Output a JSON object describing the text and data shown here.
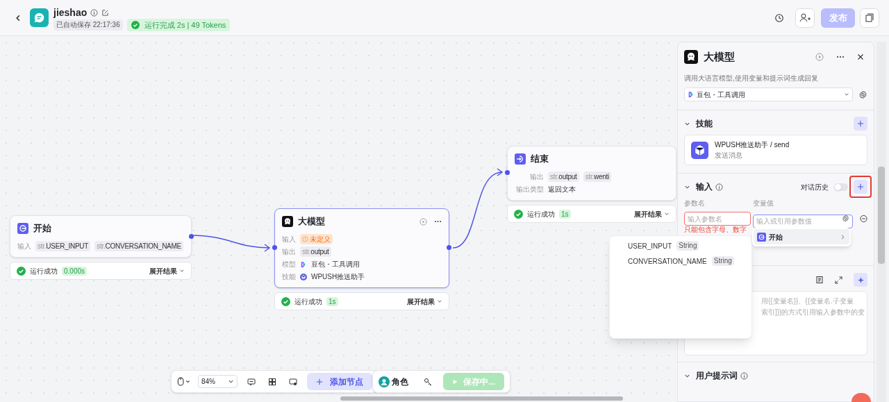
{
  "header": {
    "title": "jieshao",
    "saved": "已自动保存 22:17:36",
    "run_status": "运行完成 2s | 49 Tokens",
    "publish": "发布"
  },
  "nodes": [
    {
      "kind": "start",
      "title": "开始",
      "selected": false,
      "rows": [
        {
          "label": "输入",
          "kind": "chips",
          "chips": [
            {
              "prefix": "str.",
              "text": "USER_INPUT"
            },
            {
              "prefix": "str.",
              "text": "CONVERSATION_NAME"
            }
          ]
        }
      ],
      "result": {
        "status": "运行成功",
        "time": "0.000s",
        "expand": "展开结果"
      }
    },
    {
      "kind": "llm",
      "title": "大模型",
      "selected": true,
      "rows": [
        {
          "label": "输入",
          "kind": "warning",
          "text": "未定义"
        },
        {
          "label": "输出",
          "kind": "chips",
          "chips": [
            {
              "prefix": "str.",
              "text": "output"
            }
          ]
        },
        {
          "label": "模型",
          "kind": "model",
          "text": "豆包・工具调用"
        },
        {
          "label": "技能",
          "kind": "skill",
          "text": "WPUSH推送助手"
        }
      ],
      "result": {
        "status": "运行成功",
        "time": "1s",
        "expand": "展开结果"
      }
    },
    {
      "kind": "end",
      "title": "结束",
      "selected": false,
      "rows": [
        {
          "label": "输出",
          "kind": "chips",
          "chips": [
            {
              "prefix": "str.",
              "text": "output"
            },
            {
              "prefix": "str.",
              "text": "wenti"
            }
          ]
        },
        {
          "label": "输出类型",
          "kind": "text",
          "text": "返回文本"
        }
      ],
      "result": {
        "status": "运行成功",
        "time": "1s",
        "expand": "展开结果"
      }
    }
  ],
  "panel": {
    "title": "大模型",
    "description": "调用大语言模型,使用变量和提示词生成回复",
    "model": "豆包・工具调用",
    "skills_title": "技能",
    "skill": {
      "name": "WPUSH推送助手 / send",
      "description": "发送消息"
    },
    "input": {
      "title": "输入",
      "history_label": "对话历史",
      "history_on": false,
      "add_highlighted": true,
      "name_label": "参数名",
      "value_label": "变量值",
      "name_placeholder": "输入参数名",
      "value_placeholder": "输入或引用参数值",
      "error": "只能包含字母、数字"
    },
    "prompt_lines": [
      "用{{变量名}}、{{变量名.子变量",
      "索引]}}的方式引用输入参数中的变"
    ],
    "user_prompt_title": "用户提示词"
  },
  "variable_menu": [
    {
      "name": "USER_INPUT",
      "type": "String"
    },
    {
      "name": "CONVERSATION_NAME",
      "type": "String"
    }
  ],
  "reference_menu": {
    "node": "开始"
  },
  "toolbar": {
    "zoom": "84%",
    "add_node": "添加节点",
    "role": "角色",
    "save": "保存中..."
  }
}
